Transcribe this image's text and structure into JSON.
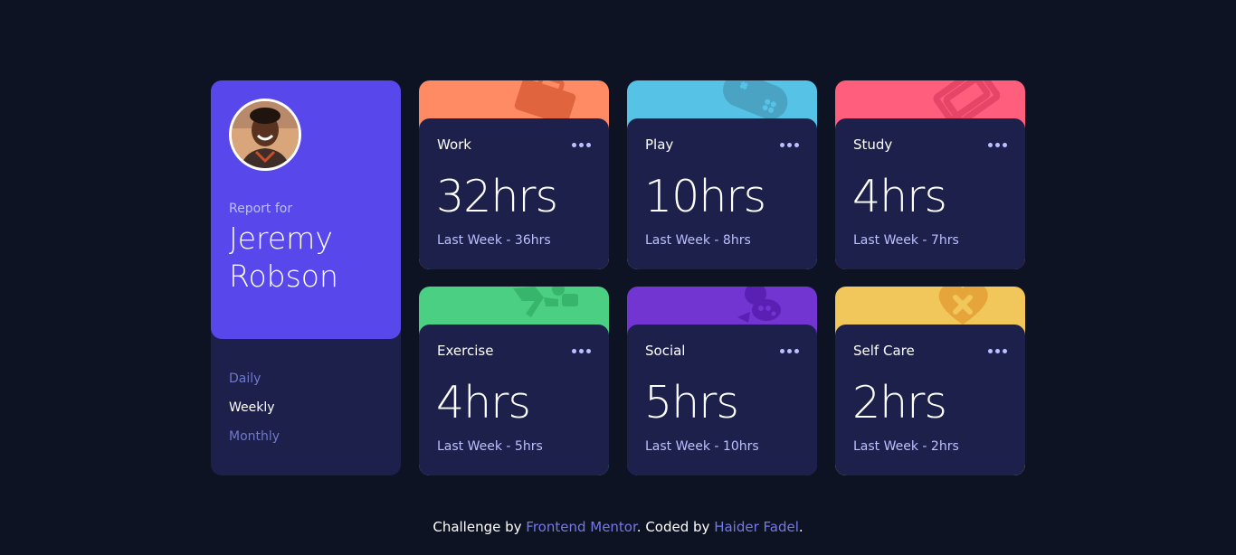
{
  "profile": {
    "report_for": "Report for",
    "name": "Jeremy Robson",
    "periods": [
      "Daily",
      "Weekly",
      "Monthly"
    ],
    "active_period": "Weekly"
  },
  "cards": [
    {
      "title": "Work",
      "hours": "32hrs",
      "last": "Last Week - 36hrs",
      "color": "#ff8b64",
      "icon": "briefcase-icon"
    },
    {
      "title": "Play",
      "hours": "10hrs",
      "last": "Last Week - 8hrs",
      "color": "#55c2e6",
      "icon": "gamepad-icon"
    },
    {
      "title": "Study",
      "hours": "4hrs",
      "last": "Last Week - 7hrs",
      "color": "#ff5e7d",
      "icon": "books-icon"
    },
    {
      "title": "Exercise",
      "hours": "4hrs",
      "last": "Last Week - 5hrs",
      "color": "#4bcf82",
      "icon": "runner-icon"
    },
    {
      "title": "Social",
      "hours": "5hrs",
      "last": "Last Week - 10hrs",
      "color": "#7335d2",
      "icon": "social-icon"
    },
    {
      "title": "Self Care",
      "hours": "2hrs",
      "last": "Last Week - 2hrs",
      "color": "#f1c75b",
      "icon": "heart-icon"
    }
  ],
  "footer": {
    "prefix": "Challenge by ",
    "link1": "Frontend Mentor",
    "middle": ". Coded by ",
    "link2": "Haider Fadel",
    "suffix": "."
  }
}
